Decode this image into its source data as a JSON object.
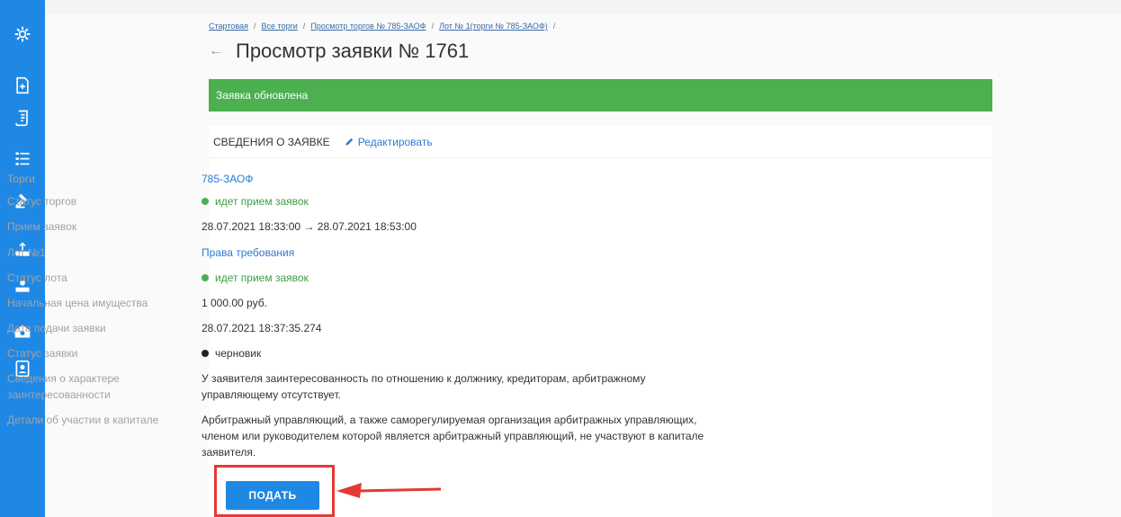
{
  "breadcrumb": {
    "items": [
      "Стартовая",
      "Все торги",
      "Просмотр торгов № 785-ЗАОФ",
      "Лот № 1(торги № 785-ЗАОФ)"
    ],
    "separator": "/"
  },
  "page": {
    "back_icon": "←",
    "title": "Просмотр заявки № 1761"
  },
  "alert": {
    "text": "Заявка обновлена",
    "color": "#4caf50"
  },
  "card": {
    "title": "СВЕДЕНИЯ О ЗАЯВКЕ",
    "edit_label": "Редактировать",
    "rows": [
      {
        "label": "Торги",
        "value": "785-ЗАОФ"
      },
      {
        "label": "Статус торгов",
        "value": "идет прием заявок"
      },
      {
        "label": "Прием заявок",
        "value": "28.07.2021 18:33:00 → 28.07.2021 18:53:00"
      },
      {
        "label": "Лот №1",
        "value": "Права требования"
      },
      {
        "label": "Статус лота",
        "value": "идет прием заявок"
      },
      {
        "label": "Начальная цена имущества",
        "value": "1 000.00 руб."
      },
      {
        "label": "Дата подачи заявки",
        "value": "28.07.2021 18:37:35.274"
      },
      {
        "label": "Статус заявки",
        "value": "черновик"
      },
      {
        "label": "Сведения о характере заинтересованности",
        "value": "У заявителя заинтересованность по отношению к должнику, кредиторам, арбитражному управляющему отсутствует."
      },
      {
        "label": "Детали об участии в капитале",
        "value": "Арбитражный управляющий, а также саморегулируемая организация арбитражных управляющих, членом или руководителем которой является арбитражный управляющий, не участвуют в капитале заявителя."
      }
    ]
  },
  "submit": {
    "label": "ПОДАТЬ"
  },
  "colors": {
    "sidebar": "#1f88e5",
    "accent": "#1e88e5",
    "highlight": "#e53935",
    "status_ok": "#4caf50"
  }
}
